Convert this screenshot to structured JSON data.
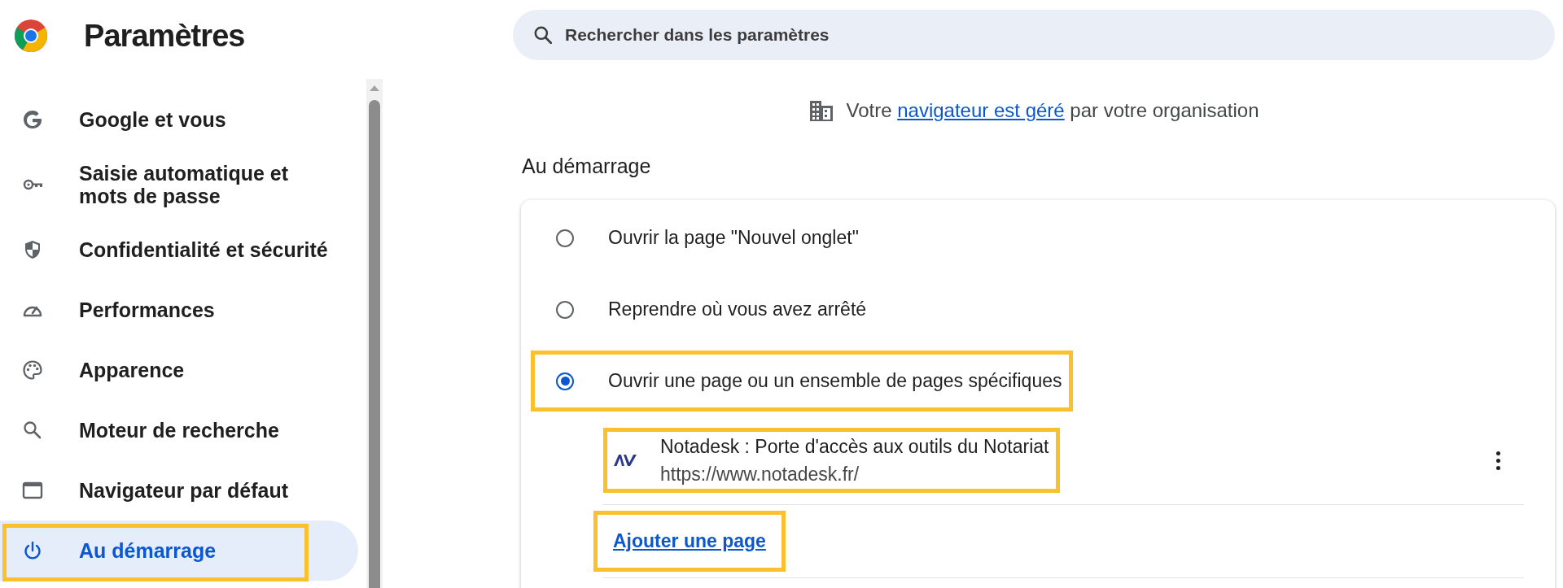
{
  "app": {
    "title": "Paramètres"
  },
  "sidebar": {
    "items": [
      {
        "kind": "google",
        "label": "Google et vous",
        "selected": false,
        "highlighted": false
      },
      {
        "kind": "key",
        "label": "Saisie automatique et mots de passe",
        "selected": false,
        "highlighted": false
      },
      {
        "kind": "shield",
        "label": "Confidentialité et sécurité",
        "selected": false,
        "highlighted": false
      },
      {
        "kind": "gauge",
        "label": "Performances",
        "selected": false,
        "highlighted": false
      },
      {
        "kind": "palette",
        "label": "Apparence",
        "selected": false,
        "highlighted": false
      },
      {
        "kind": "search",
        "label": "Moteur de recherche",
        "selected": false,
        "highlighted": false
      },
      {
        "kind": "window",
        "label": "Navigateur par défaut",
        "selected": false,
        "highlighted": false
      },
      {
        "kind": "power",
        "label": "Au démarrage",
        "selected": true,
        "highlighted": true
      }
    ]
  },
  "search": {
    "placeholder": "Rechercher dans les paramètres"
  },
  "managed_notice": {
    "before": "Votre",
    "link": "navigateur est géré",
    "after": "par votre organisation"
  },
  "section": {
    "title": "Au démarrage",
    "options": [
      {
        "label": "Ouvrir la page \"Nouvel onglet\"",
        "selected": false,
        "highlighted": false
      },
      {
        "label": "Reprendre où vous avez arrêté",
        "selected": false,
        "highlighted": false
      },
      {
        "label": "Ouvrir une page ou un ensemble de pages spécifiques",
        "selected": true,
        "highlighted": true
      }
    ],
    "pages": [
      {
        "title": "Notadesk : Porte d'accès aux outils du Notariat",
        "url": "https://www.notadesk.fr/",
        "highlighted": true
      }
    ],
    "add_link": {
      "label": "Ajouter une page",
      "highlighted": true
    }
  }
}
